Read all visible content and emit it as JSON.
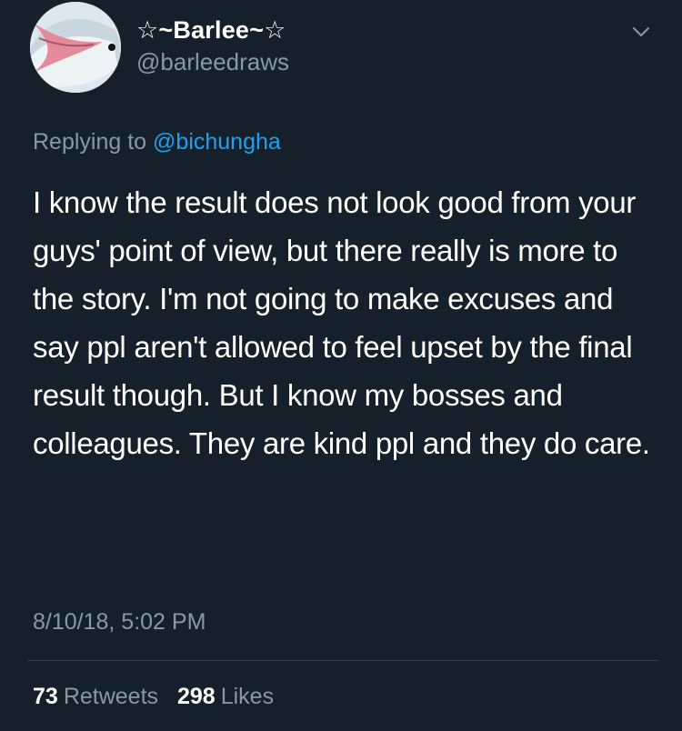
{
  "author": {
    "display_name": "☆~Barlee~☆",
    "handle": "@barleedraws",
    "avatar_icon": "dolphin-avatar-icon"
  },
  "reply": {
    "prefix": "Replying to",
    "mention": "@bichungha"
  },
  "tweet": {
    "text": "I know the result does not look good from your guys' point of view, but there really is more to the story. I'm not going to make excuses and say ppl aren't allowed to feel upset by the final result though. But I know my bosses and colleagues. They are kind ppl and they do care.",
    "timestamp": "8/10/18, 5:02 PM"
  },
  "stats": {
    "retweets_count": "73",
    "retweets_label": "Retweets",
    "likes_count": "298",
    "likes_label": "Likes"
  },
  "colors": {
    "background": "#15202b",
    "text": "#ffffff",
    "secondary_text": "#8899a6",
    "link": "#1da1f2",
    "divider": "#38444d"
  }
}
